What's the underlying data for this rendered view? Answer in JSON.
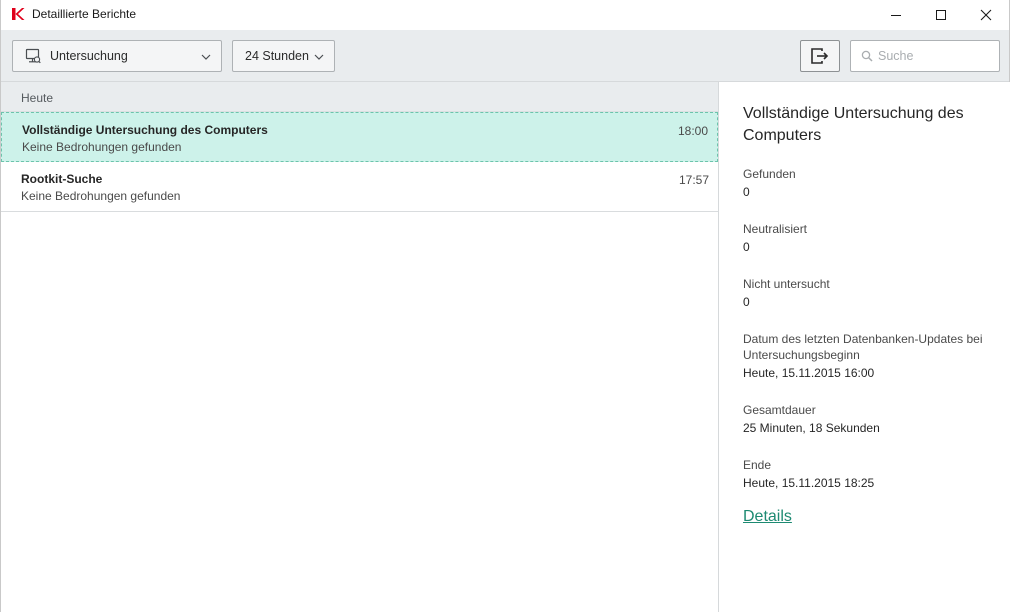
{
  "window": {
    "title": "Detaillierte Berichte",
    "accent_color": "#e0001b"
  },
  "toolbar": {
    "type_select": {
      "value": "Untersuchung",
      "icon": "monitor-icon"
    },
    "period_select": {
      "value": "24 Stunden"
    },
    "export_button": {
      "icon": "export-icon"
    },
    "search": {
      "placeholder": "Suche",
      "icon": "search-icon"
    }
  },
  "list": {
    "group_header": "Heute",
    "rows": [
      {
        "title": "Vollständige Untersuchung des Computers",
        "subtitle": "Keine Bedrohungen gefunden",
        "time": "18:00",
        "selected": true
      },
      {
        "title": "Rootkit-Suche",
        "subtitle": "Keine Bedrohungen gefunden",
        "time": "17:57",
        "selected": false
      }
    ],
    "selected_color": "#cdf2ea"
  },
  "details": {
    "title": "Vollständige Untersuchung des Computers",
    "fields": [
      {
        "label": "Gefunden",
        "value": "0"
      },
      {
        "label": "Neutralisiert",
        "value": "0"
      },
      {
        "label": "Nicht untersucht",
        "value": "0"
      },
      {
        "label": "Datum des letzten Datenbanken-Updates bei Untersuchungsbeginn",
        "value": "Heute, 15.11.2015 16:00"
      },
      {
        "label": "Gesamtdauer",
        "value": "25 Minuten, 18 Sekunden"
      },
      {
        "label": "Ende",
        "value": "Heute, 15.11.2015 18:25"
      }
    ],
    "link_label": "Details",
    "link_color": "#1d8a72"
  }
}
